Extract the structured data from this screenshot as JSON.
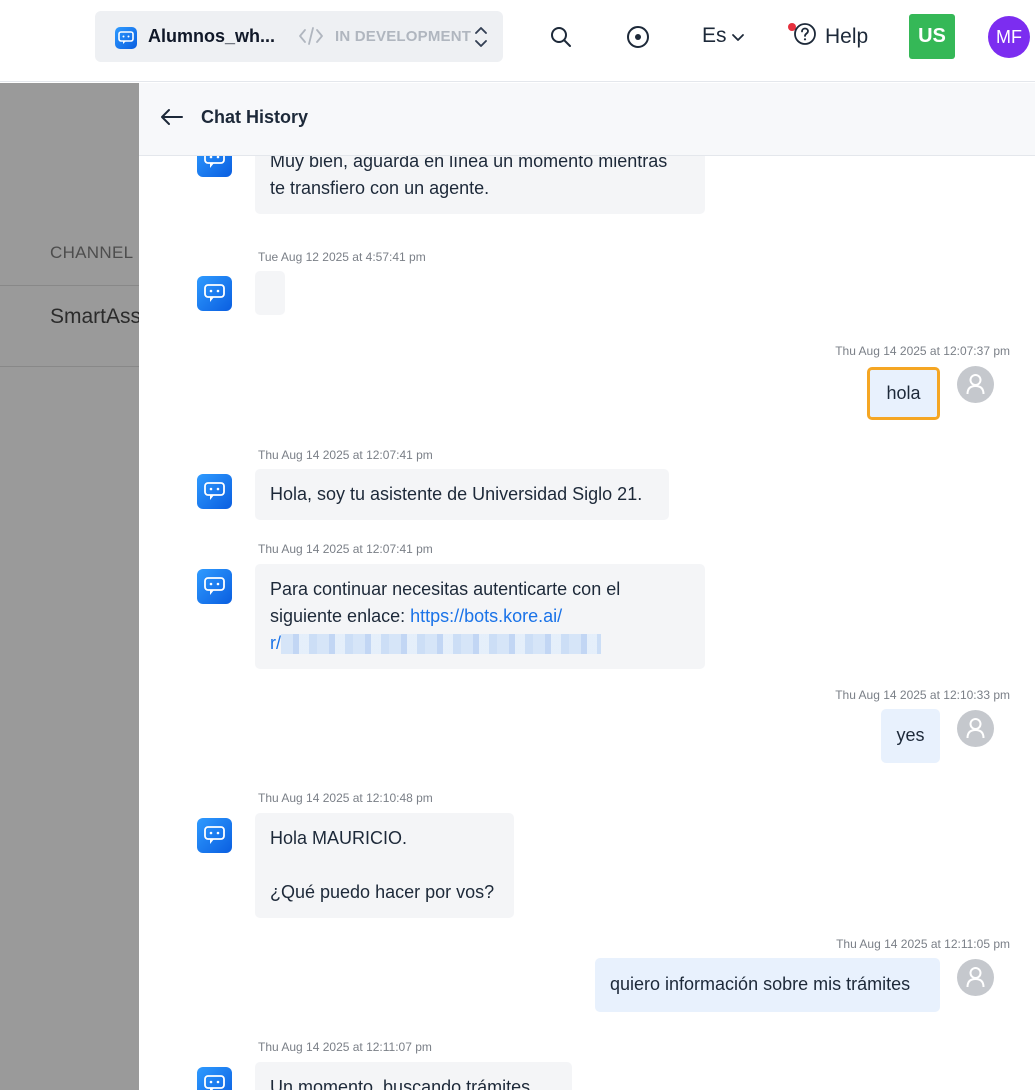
{
  "topbar": {
    "app_name": "Alumnos_wh...",
    "environment": "IN DEVELOPMENT",
    "language": "Es",
    "help_label": "Help",
    "workspace_badge": "US",
    "user_initials": "MF",
    "colors": {
      "workspace_badge": "#35b857",
      "avatar": "#7c2df0",
      "notification_dot": "#e5303d"
    }
  },
  "background_page": {
    "column_label": "CHANNEL",
    "row_text": "SmartAss"
  },
  "panel": {
    "title": "Chat History",
    "messages": [
      {
        "from": "bot",
        "lines": [
          "Muy bien, aguarda en línea un momento mientras",
          "te transfiero con un agente."
        ]
      },
      {
        "from": "bot",
        "timestamp": "Tue Aug 12 2025 at 4:57:41 pm",
        "text": ""
      },
      {
        "from": "user",
        "timestamp": "Thu Aug 14 2025 at 12:07:37 pm",
        "text": "hola"
      },
      {
        "from": "bot",
        "timestamp": "Thu Aug 14 2025 at 12:07:41 pm",
        "text": "Hola, soy tu asistente de Universidad Siglo 21."
      },
      {
        "from": "bot",
        "timestamp": "Thu Aug 14 2025 at 12:07:41 pm",
        "lines": [
          "Para continuar necesitas autenticarte con el",
          "siguiente enlace: "
        ],
        "link_part1": "https://bots.kore.ai/",
        "link_part2": "r/"
      },
      {
        "from": "user",
        "timestamp": "Thu Aug 14 2025 at 12:10:33 pm",
        "text": "yes"
      },
      {
        "from": "bot",
        "timestamp": "Thu Aug 14 2025 at 12:10:48 pm",
        "lines": [
          "Hola MAURICIO.",
          "¿Qué puedo hacer por vos?"
        ]
      },
      {
        "from": "user",
        "timestamp": "Thu Aug 14 2025 at 12:11:05 pm",
        "text": "quiero información sobre mis trámites"
      },
      {
        "from": "bot",
        "timestamp": "Thu Aug 14 2025 at 12:11:07 pm",
        "text": "Un momento, buscando trámites..."
      }
    ]
  }
}
